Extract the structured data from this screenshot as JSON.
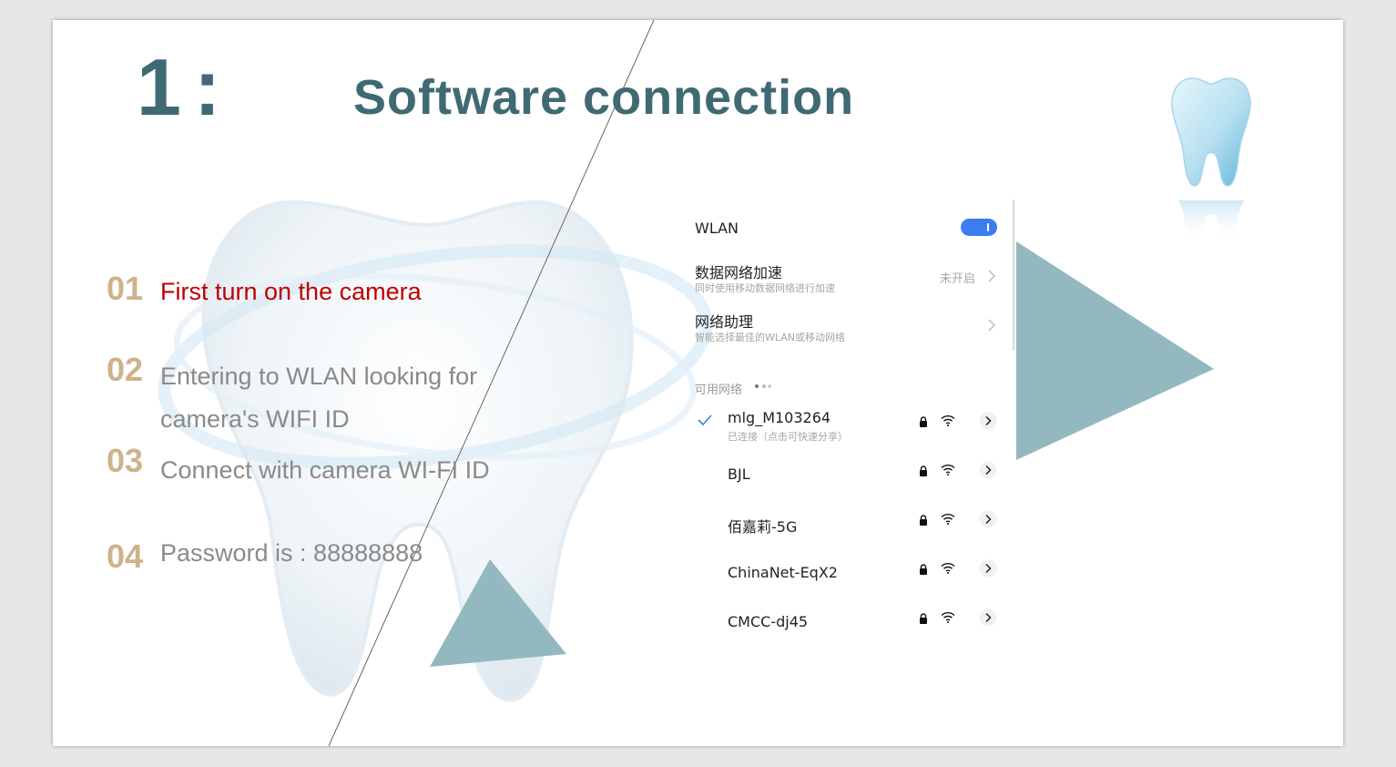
{
  "slide": {
    "number": "1:",
    "title": "Software connection",
    "steps": [
      {
        "num": "01",
        "lines": [
          "First turn on the camera"
        ]
      },
      {
        "num": "02",
        "lines": [
          "Entering to WLAN looking for",
          "camera's WIFI ID"
        ]
      },
      {
        "num": "03",
        "lines": [
          "Connect with camera WI-FI ID"
        ]
      },
      {
        "num": "04",
        "lines": [
          "Password is : 88888888"
        ]
      }
    ]
  },
  "phone": {
    "wlan": {
      "label": "WLAN",
      "enabled": true
    },
    "data_accel": {
      "title": "数据网络加速",
      "subtitle": "同时使用移动数据网络进行加速",
      "value": "未开启"
    },
    "net_assistant": {
      "title": "网络助理",
      "subtitle": "智能选择最佳的WLAN或移动网络"
    },
    "available_label": "可用网络",
    "networks": [
      {
        "name": "mlg_M103264",
        "status": "已连接（点击可快速分享）",
        "connected": true,
        "locked": true
      },
      {
        "name": "BJL",
        "status": "",
        "connected": false,
        "locked": true
      },
      {
        "name": "佰嘉莉-5G",
        "status": "",
        "connected": false,
        "locked": true
      },
      {
        "name": "ChinaNet-EqX2",
        "status": "",
        "connected": false,
        "locked": true
      },
      {
        "name": "CMCC-dj45",
        "status": "",
        "connected": false,
        "locked": true
      }
    ]
  },
  "colors": {
    "title": "#3f6a73",
    "step_number": "#cdb38b",
    "step_text": "#8a8a8a",
    "step_highlight": "#c00000",
    "triangle": "#93b8c0",
    "toggle": "#3b7df0"
  },
  "icons": [
    "tooth-background-image",
    "tooth-icon",
    "check-icon",
    "lock-icon",
    "wifi-icon",
    "chevron-right-icon"
  ]
}
